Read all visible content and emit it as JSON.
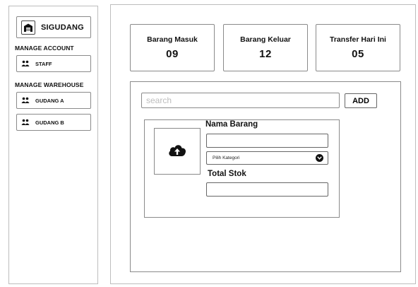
{
  "app": {
    "title": "SIGUDANG",
    "logo_icon": "warehouse-icon"
  },
  "sidebar": {
    "sections": [
      {
        "label": "MANAGE ACCOUNT",
        "items": [
          {
            "label": "STAFF",
            "icon": "users-icon"
          }
        ]
      },
      {
        "label": "MANAGE WAREHOUSE",
        "items": [
          {
            "label": "GUDANG A",
            "icon": "users-icon"
          },
          {
            "label": "GUDANG B",
            "icon": "users-icon"
          }
        ]
      }
    ]
  },
  "stats": [
    {
      "label": "Barang Masuk",
      "value": "09"
    },
    {
      "label": "Barang Keluar",
      "value": "12"
    },
    {
      "label": "Transfer Hari Ini",
      "value": "05"
    }
  ],
  "search": {
    "placeholder": "search",
    "value": ""
  },
  "toolbar": {
    "add_label": "ADD"
  },
  "form": {
    "upload_icon": "cloud-upload-icon",
    "nama_barang_label": "Nama Barang",
    "nama_barang_value": "",
    "kategori_placeholder": "Pilih Kategori",
    "total_stok_label": "Total Stok",
    "total_stok_value": ""
  },
  "colors": {
    "border": "#8a8a8a",
    "text": "#111111",
    "placeholder": "#bdbdbd"
  }
}
